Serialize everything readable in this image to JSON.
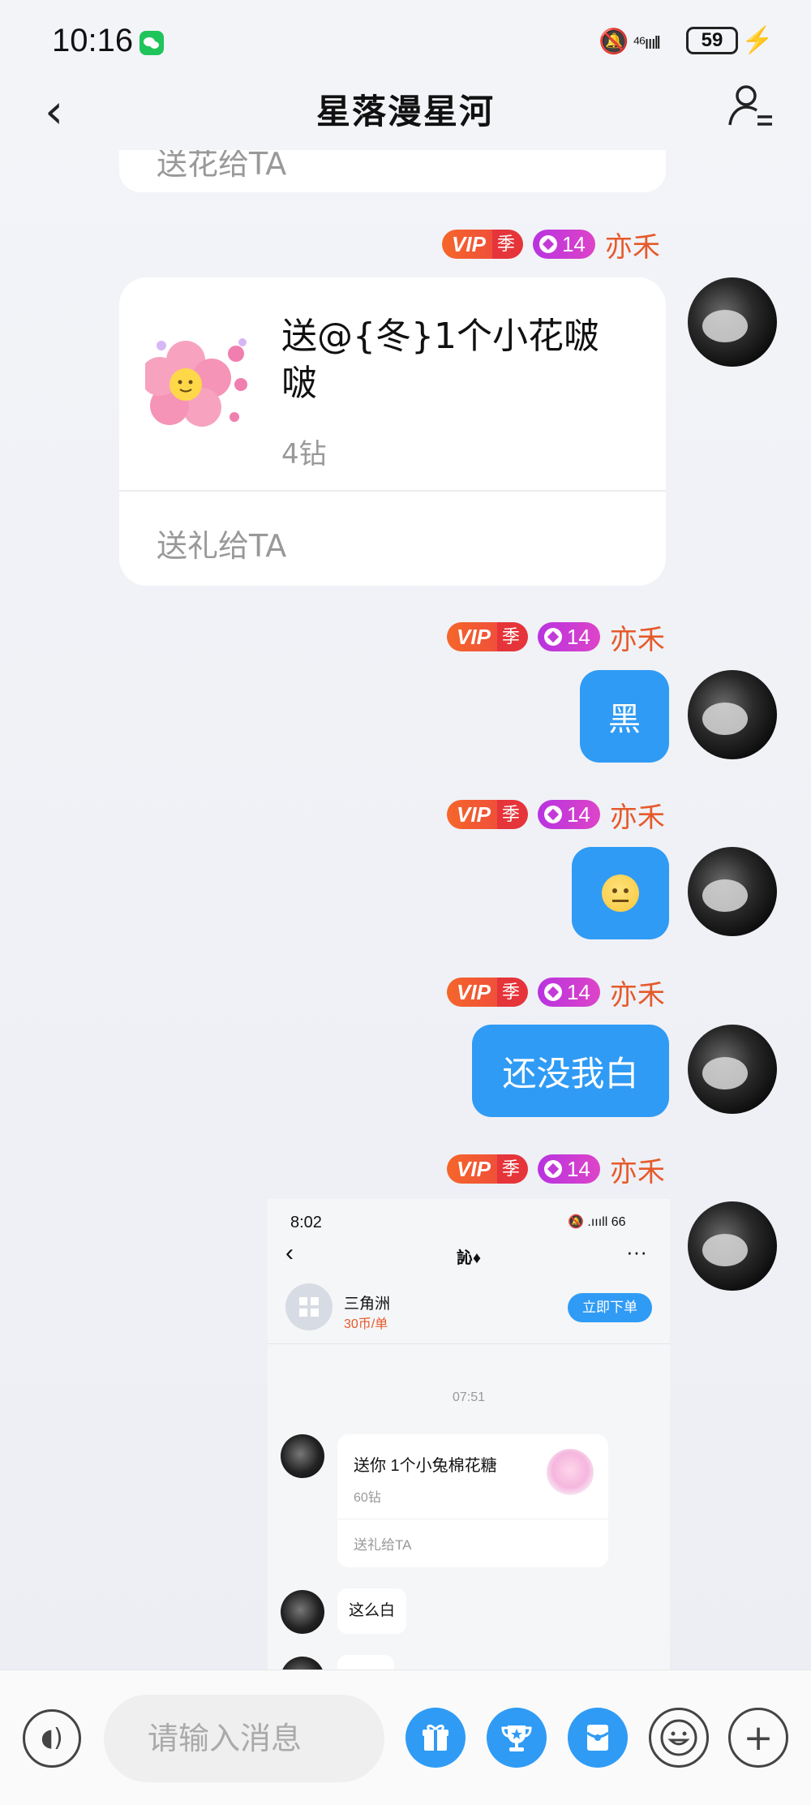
{
  "status_bar": {
    "time": "10:16",
    "signal_label": "⁴⁶ıııll",
    "battery": "59"
  },
  "header": {
    "title": "星落漫星河",
    "back_icon": "chevron-left-icon",
    "profile_icon": "user-menu-icon"
  },
  "top_card": {
    "send_label": "送花给TA"
  },
  "badges": {
    "vip": "VIP",
    "season": "季",
    "level": "14",
    "username": "亦禾"
  },
  "gift_card": {
    "name": "送@{冬}1个小花啵啵",
    "price": "4钻",
    "send_label": "送礼给TA"
  },
  "messages": [
    {
      "type": "text",
      "text": "黑"
    },
    {
      "type": "emoji",
      "emoji": "neutral-face"
    },
    {
      "type": "text",
      "text": "还没我白"
    }
  ],
  "embedded_screenshot": {
    "time": "8:02",
    "status": "🔕 .ıııll 66",
    "title": "訫♦",
    "game_name": "三角洲",
    "game_price": "30币/单",
    "order_button": "立即下单",
    "timestamp": "07:51",
    "gift_name": "送你 1个小兔棉花糖",
    "gift_price": "60钻",
    "gift_send": "送礼给TA",
    "message": "这么白"
  },
  "input": {
    "placeholder": "请输入消息"
  },
  "accent_color": "#2f9bf5",
  "username_color": "#e55a2b"
}
